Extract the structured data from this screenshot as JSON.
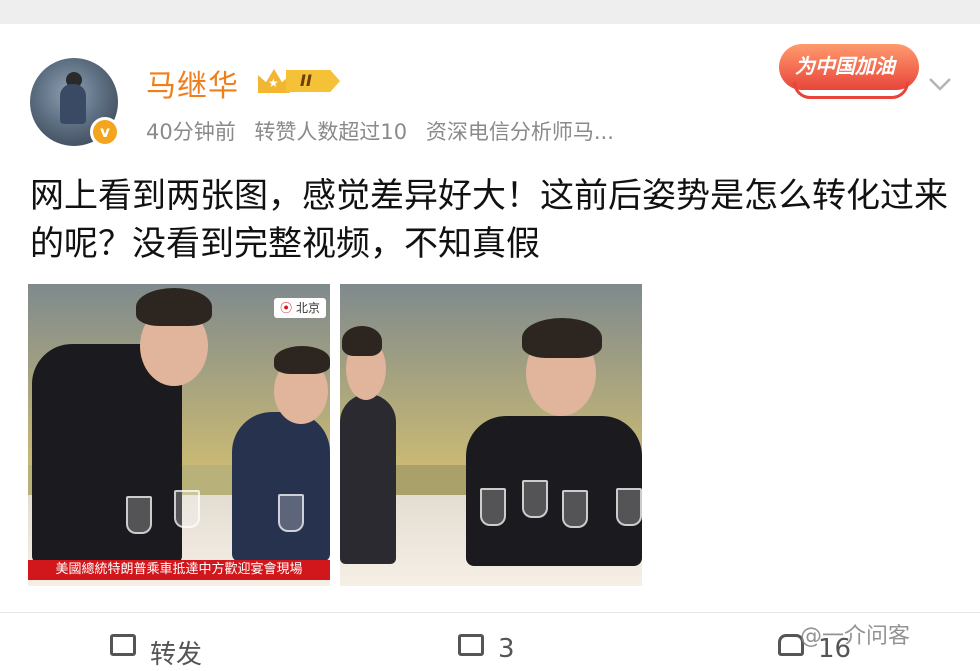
{
  "post": {
    "username": "马继华",
    "vip_level": "II",
    "verified_mark": "v",
    "time": "40分钟前",
    "repost_note": "转赞人数超过10",
    "bio": "资深电信分析师马...",
    "promo_badge": "为中国加油",
    "text": "网上看到两张图，感觉差异好大！这前后姿势是怎么转化过来的呢？没看到完整视频，不知真假",
    "image1": {
      "location_tag": "北京",
      "caption": "美國總統特朗普乘車抵達中方歡迎宴會現場"
    }
  },
  "actions": {
    "repost_label": "转发",
    "comment_count": "3",
    "like_count": "16"
  },
  "watermark": "@一介问客",
  "icons": [
    "avatar",
    "verified-icon",
    "vip-crown-icon",
    "chevron-down-icon",
    "location-pin-icon",
    "repost-icon",
    "comment-icon",
    "like-icon"
  ],
  "colors": {
    "username": "#f07f1b",
    "badge": "#f4a51d",
    "promo": "#e8453a",
    "caption_bg": "#d2171c"
  }
}
